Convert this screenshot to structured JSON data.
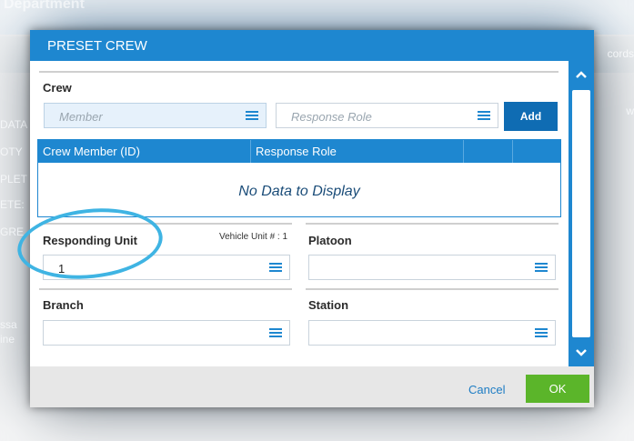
{
  "background": {
    "header_text": "Department",
    "left_fragments": [
      "DATA",
      "OTY",
      "PLET",
      "ETE:",
      "GRE",
      "ssa",
      "ine"
    ],
    "right_fragments": [
      "cords",
      "w"
    ]
  },
  "modal": {
    "title": "PRESET CREW",
    "crew": {
      "section_label": "Crew",
      "member_placeholder": "Member",
      "response_role_placeholder": "Response Role",
      "add_label": "Add",
      "grid": {
        "columns": [
          "Crew Member (ID)",
          "Response Role",
          "",
          ""
        ],
        "empty_text": "No Data to Display"
      }
    },
    "responding_unit": {
      "label": "Responding Unit",
      "vehicle_unit_text": "Vehicle Unit # : 1",
      "value": "1"
    },
    "platoon": {
      "label": "Platoon",
      "value": ""
    },
    "branch": {
      "label": "Branch",
      "value": ""
    },
    "station": {
      "label": "Station",
      "value": ""
    },
    "footer": {
      "cancel_label": "Cancel",
      "ok_label": "OK"
    }
  },
  "colors": {
    "header_blue": "#1e87d0",
    "add_blue": "#0f6cb3",
    "ok_green": "#5bb52a",
    "annotation": "#3fb4e3"
  },
  "icons": [
    "list-icon",
    "chevron-up-icon",
    "chevron-down-icon"
  ]
}
